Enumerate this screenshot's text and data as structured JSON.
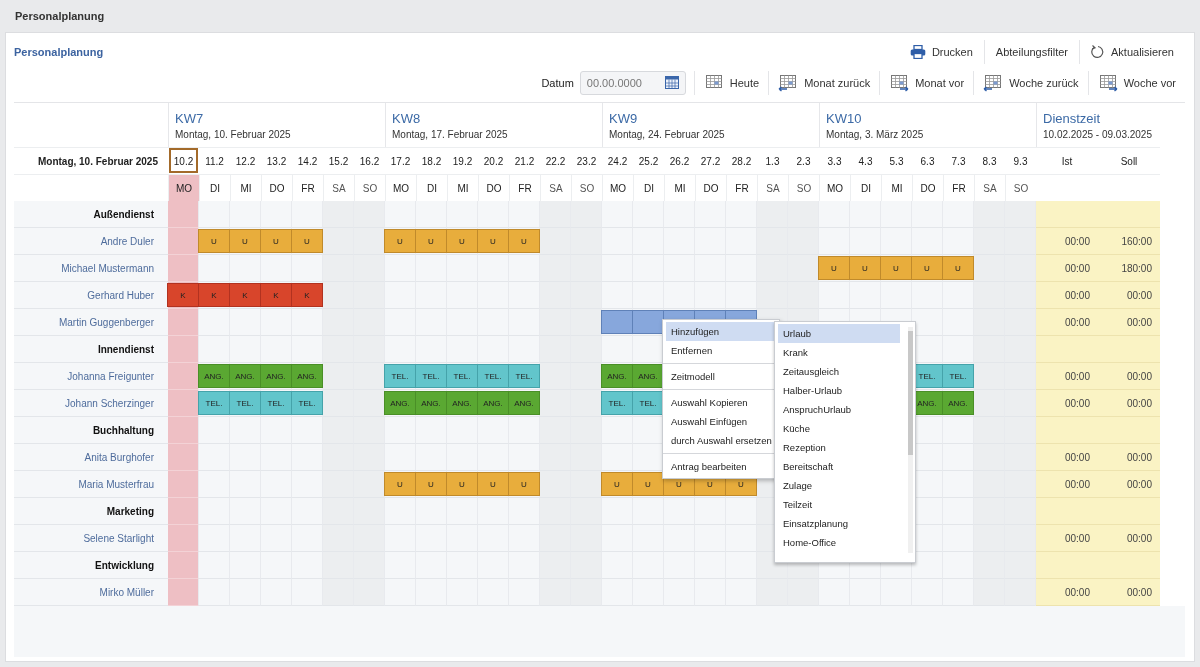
{
  "app_title": "Personalplanung",
  "panel_title": "Personalplanung",
  "toolbar_top": [
    {
      "label": "Drucken",
      "kind": "print"
    },
    {
      "label": "Abteilungsfilter",
      "kind": "plain"
    },
    {
      "label": "Aktualisieren",
      "kind": "refresh"
    }
  ],
  "date_field": {
    "label": "Datum",
    "placeholder": "00.00.0000"
  },
  "nav_buttons": [
    {
      "label": "Heute",
      "kind": "today"
    },
    {
      "label": "Monat zurück",
      "kind": "back"
    },
    {
      "label": "Monat vor",
      "kind": "forward"
    },
    {
      "label": "Woche zurück",
      "kind": "back"
    },
    {
      "label": "Woche vor",
      "kind": "forward"
    }
  ],
  "corner_label": "Montag, 10. Februar 2025",
  "weeks": [
    {
      "title": "KW7",
      "subtitle": "Montag, 10. Februar 2025",
      "days": [
        {
          "date": "10.2",
          "weekday": "MO",
          "selected": true,
          "weekend": false
        },
        {
          "date": "11.2",
          "weekday": "DI",
          "selected": false,
          "weekend": false
        },
        {
          "date": "12.2",
          "weekday": "MI",
          "selected": false,
          "weekend": false
        },
        {
          "date": "13.2",
          "weekday": "DO",
          "selected": false,
          "weekend": false
        },
        {
          "date": "14.2",
          "weekday": "FR",
          "selected": false,
          "weekend": false
        },
        {
          "date": "15.2",
          "weekday": "SA",
          "selected": false,
          "weekend": true
        },
        {
          "date": "16.2",
          "weekday": "SO",
          "selected": false,
          "weekend": true
        }
      ]
    },
    {
      "title": "KW8",
      "subtitle": "Montag, 17. Februar 2025",
      "days": [
        {
          "date": "17.2",
          "weekday": "MO",
          "selected": false,
          "weekend": false
        },
        {
          "date": "18.2",
          "weekday": "DI",
          "selected": false,
          "weekend": false
        },
        {
          "date": "19.2",
          "weekday": "MI",
          "selected": false,
          "weekend": false
        },
        {
          "date": "20.2",
          "weekday": "DO",
          "selected": false,
          "weekend": false
        },
        {
          "date": "21.2",
          "weekday": "FR",
          "selected": false,
          "weekend": false
        },
        {
          "date": "22.2",
          "weekday": "SA",
          "selected": false,
          "weekend": true
        },
        {
          "date": "23.2",
          "weekday": "SO",
          "selected": false,
          "weekend": true
        }
      ]
    },
    {
      "title": "KW9",
      "subtitle": "Montag, 24. Februar 2025",
      "days": [
        {
          "date": "24.2",
          "weekday": "MO",
          "selected": false,
          "weekend": false
        },
        {
          "date": "25.2",
          "weekday": "DI",
          "selected": false,
          "weekend": false
        },
        {
          "date": "26.2",
          "weekday": "MI",
          "selected": false,
          "weekend": false
        },
        {
          "date": "27.2",
          "weekday": "DO",
          "selected": false,
          "weekend": false
        },
        {
          "date": "28.2",
          "weekday": "FR",
          "selected": false,
          "weekend": false
        },
        {
          "date": "1.3",
          "weekday": "SA",
          "selected": false,
          "weekend": true
        },
        {
          "date": "2.3",
          "weekday": "SO",
          "selected": false,
          "weekend": true
        }
      ]
    },
    {
      "title": "KW10",
      "subtitle": "Montag, 3. März 2025",
      "days": [
        {
          "date": "3.3",
          "weekday": "MO",
          "selected": false,
          "weekend": false
        },
        {
          "date": "4.3",
          "weekday": "DI",
          "selected": false,
          "weekend": false
        },
        {
          "date": "5.3",
          "weekday": "MI",
          "selected": false,
          "weekend": false
        },
        {
          "date": "6.3",
          "weekday": "DO",
          "selected": false,
          "weekend": false
        },
        {
          "date": "7.3",
          "weekday": "FR",
          "selected": false,
          "weekend": false
        },
        {
          "date": "8.3",
          "weekday": "SA",
          "selected": false,
          "weekend": true
        },
        {
          "date": "9.3",
          "weekday": "SO",
          "selected": false,
          "weekend": true
        }
      ]
    }
  ],
  "totals_header": {
    "title": "Dienstzeit",
    "range": "10.02.2025 - 09.03.2025",
    "columns": [
      "Ist",
      "Soll"
    ]
  },
  "rows": [
    {
      "kind": "group",
      "label": "Außendienst"
    },
    {
      "kind": "person",
      "label": "Andre Duler",
      "ist": "00:00",
      "soll": "160:00",
      "cells": [
        {
          "kind": "empty"
        },
        {
          "kind": "vacation",
          "code": "U"
        },
        {
          "kind": "vacation",
          "code": "U"
        },
        {
          "kind": "vacation",
          "code": "U"
        },
        {
          "kind": "vacation",
          "code": "U"
        },
        {
          "kind": "empty"
        },
        {
          "kind": "empty"
        },
        {
          "kind": "vacation",
          "code": "U"
        },
        {
          "kind": "vacation",
          "code": "U"
        },
        {
          "kind": "vacation",
          "code": "U"
        },
        {
          "kind": "vacation",
          "code": "U"
        },
        {
          "kind": "vacation",
          "code": "U"
        },
        {
          "kind": "empty"
        },
        {
          "kind": "empty"
        },
        {
          "kind": "empty"
        },
        {
          "kind": "empty"
        },
        {
          "kind": "empty"
        },
        {
          "kind": "empty"
        },
        {
          "kind": "empty"
        },
        {
          "kind": "empty"
        },
        {
          "kind": "empty"
        },
        {
          "kind": "empty"
        },
        {
          "kind": "empty"
        },
        {
          "kind": "empty"
        },
        {
          "kind": "empty"
        },
        {
          "kind": "empty"
        },
        {
          "kind": "empty"
        },
        {
          "kind": "empty"
        }
      ]
    },
    {
      "kind": "person",
      "label": "Michael Mustermann",
      "ist": "00:00",
      "soll": "180:00",
      "cells": [
        {
          "kind": "empty"
        },
        {
          "kind": "empty"
        },
        {
          "kind": "empty"
        },
        {
          "kind": "empty"
        },
        {
          "kind": "empty"
        },
        {
          "kind": "empty"
        },
        {
          "kind": "empty"
        },
        {
          "kind": "empty"
        },
        {
          "kind": "empty"
        },
        {
          "kind": "empty"
        },
        {
          "kind": "empty"
        },
        {
          "kind": "empty"
        },
        {
          "kind": "empty"
        },
        {
          "kind": "empty"
        },
        {
          "kind": "empty"
        },
        {
          "kind": "empty"
        },
        {
          "kind": "empty"
        },
        {
          "kind": "empty"
        },
        {
          "kind": "empty"
        },
        {
          "kind": "empty"
        },
        {
          "kind": "empty"
        },
        {
          "kind": "vacation",
          "code": "U"
        },
        {
          "kind": "vacation",
          "code": "U"
        },
        {
          "kind": "vacation",
          "code": "U"
        },
        {
          "kind": "vacation",
          "code": "U"
        },
        {
          "kind": "vacation",
          "code": "U"
        },
        {
          "kind": "empty"
        },
        {
          "kind": "empty"
        }
      ]
    },
    {
      "kind": "person",
      "label": "Gerhard Huber",
      "ist": "00:00",
      "soll": "00:00",
      "cells": [
        {
          "kind": "sick",
          "code": "K"
        },
        {
          "kind": "sick",
          "code": "K"
        },
        {
          "kind": "sick",
          "code": "K"
        },
        {
          "kind": "sick",
          "code": "K"
        },
        {
          "kind": "sick",
          "code": "K"
        },
        {
          "kind": "empty"
        },
        {
          "kind": "empty"
        },
        {
          "kind": "empty"
        },
        {
          "kind": "empty"
        },
        {
          "kind": "empty"
        },
        {
          "kind": "empty"
        },
        {
          "kind": "empty"
        },
        {
          "kind": "empty"
        },
        {
          "kind": "empty"
        },
        {
          "kind": "empty"
        },
        {
          "kind": "empty"
        },
        {
          "kind": "empty"
        },
        {
          "kind": "empty"
        },
        {
          "kind": "empty"
        },
        {
          "kind": "empty"
        },
        {
          "kind": "empty"
        },
        {
          "kind": "empty"
        },
        {
          "kind": "empty"
        },
        {
          "kind": "empty"
        },
        {
          "kind": "empty"
        },
        {
          "kind": "empty"
        },
        {
          "kind": "empty"
        },
        {
          "kind": "empty"
        }
      ]
    },
    {
      "kind": "person",
      "label": "Martin Guggenberger",
      "ist": "00:00",
      "soll": "00:00",
      "cells": [
        {
          "kind": "empty"
        },
        {
          "kind": "empty"
        },
        {
          "kind": "empty"
        },
        {
          "kind": "empty"
        },
        {
          "kind": "empty"
        },
        {
          "kind": "empty"
        },
        {
          "kind": "empty"
        },
        {
          "kind": "empty"
        },
        {
          "kind": "empty"
        },
        {
          "kind": "empty"
        },
        {
          "kind": "empty"
        },
        {
          "kind": "empty"
        },
        {
          "kind": "empty"
        },
        {
          "kind": "empty"
        },
        {
          "kind": "selection"
        },
        {
          "kind": "selection"
        },
        {
          "kind": "selection"
        },
        {
          "kind": "selection"
        },
        {
          "kind": "selection"
        },
        {
          "kind": "empty"
        },
        {
          "kind": "empty"
        },
        {
          "kind": "empty"
        },
        {
          "kind": "empty"
        },
        {
          "kind": "empty"
        },
        {
          "kind": "empty"
        },
        {
          "kind": "empty"
        },
        {
          "kind": "empty"
        },
        {
          "kind": "empty"
        }
      ]
    },
    {
      "kind": "group",
      "label": "Innendienst"
    },
    {
      "kind": "person",
      "label": "Johanna Freigunter",
      "ist": "00:00",
      "soll": "00:00",
      "cells": [
        {
          "kind": "empty"
        },
        {
          "kind": "presence",
          "code": "ANG."
        },
        {
          "kind": "presence",
          "code": "ANG."
        },
        {
          "kind": "presence",
          "code": "ANG."
        },
        {
          "kind": "presence",
          "code": "ANG."
        },
        {
          "kind": "empty"
        },
        {
          "kind": "empty"
        },
        {
          "kind": "phone",
          "code": "TEL."
        },
        {
          "kind": "phone",
          "code": "TEL."
        },
        {
          "kind": "phone",
          "code": "TEL."
        },
        {
          "kind": "phone",
          "code": "TEL."
        },
        {
          "kind": "phone",
          "code": "TEL."
        },
        {
          "kind": "empty"
        },
        {
          "kind": "empty"
        },
        {
          "kind": "presence",
          "code": "ANG."
        },
        {
          "kind": "presence",
          "code": "ANG."
        },
        {
          "kind": "empty"
        },
        {
          "kind": "empty"
        },
        {
          "kind": "empty"
        },
        {
          "kind": "empty"
        },
        {
          "kind": "empty"
        },
        {
          "kind": "empty"
        },
        {
          "kind": "empty"
        },
        {
          "kind": "empty"
        },
        {
          "kind": "phone",
          "code": "TEL."
        },
        {
          "kind": "phone",
          "code": "TEL."
        },
        {
          "kind": "empty"
        },
        {
          "kind": "empty"
        }
      ]
    },
    {
      "kind": "person",
      "label": "Johann Scherzinger",
      "ist": "00:00",
      "soll": "00:00",
      "cells": [
        {
          "kind": "empty"
        },
        {
          "kind": "phone",
          "code": "TEL."
        },
        {
          "kind": "phone",
          "code": "TEL."
        },
        {
          "kind": "phone",
          "code": "TEL."
        },
        {
          "kind": "phone",
          "code": "TEL."
        },
        {
          "kind": "empty"
        },
        {
          "kind": "empty"
        },
        {
          "kind": "presence",
          "code": "ANG."
        },
        {
          "kind": "presence",
          "code": "ANG."
        },
        {
          "kind": "presence",
          "code": "ANG."
        },
        {
          "kind": "presence",
          "code": "ANG."
        },
        {
          "kind": "presence",
          "code": "ANG."
        },
        {
          "kind": "empty"
        },
        {
          "kind": "empty"
        },
        {
          "kind": "phone",
          "code": "TEL."
        },
        {
          "kind": "phone",
          "code": "TEL."
        },
        {
          "kind": "empty"
        },
        {
          "kind": "empty"
        },
        {
          "kind": "empty"
        },
        {
          "kind": "empty"
        },
        {
          "kind": "empty"
        },
        {
          "kind": "empty"
        },
        {
          "kind": "empty"
        },
        {
          "kind": "empty"
        },
        {
          "kind": "presence",
          "code": "ANG."
        },
        {
          "kind": "presence",
          "code": "ANG."
        },
        {
          "kind": "empty"
        },
        {
          "kind": "empty"
        }
      ]
    },
    {
      "kind": "group",
      "label": "Buchhaltung"
    },
    {
      "kind": "person",
      "label": "Anita Burghofer",
      "ist": "00:00",
      "soll": "00:00",
      "cells": [
        {
          "kind": "empty"
        },
        {
          "kind": "empty"
        },
        {
          "kind": "empty"
        },
        {
          "kind": "empty"
        },
        {
          "kind": "empty"
        },
        {
          "kind": "empty"
        },
        {
          "kind": "empty"
        },
        {
          "kind": "empty"
        },
        {
          "kind": "empty"
        },
        {
          "kind": "empty"
        },
        {
          "kind": "empty"
        },
        {
          "kind": "empty"
        },
        {
          "kind": "empty"
        },
        {
          "kind": "empty"
        },
        {
          "kind": "empty"
        },
        {
          "kind": "empty"
        },
        {
          "kind": "empty"
        },
        {
          "kind": "empty"
        },
        {
          "kind": "empty"
        },
        {
          "kind": "empty"
        },
        {
          "kind": "empty"
        },
        {
          "kind": "empty"
        },
        {
          "kind": "empty"
        },
        {
          "kind": "empty"
        },
        {
          "kind": "empty"
        },
        {
          "kind": "empty"
        },
        {
          "kind": "empty"
        },
        {
          "kind": "empty"
        }
      ]
    },
    {
      "kind": "person",
      "label": "Maria Musterfrau",
      "ist": "00:00",
      "soll": "00:00",
      "cells": [
        {
          "kind": "empty"
        },
        {
          "kind": "empty"
        },
        {
          "kind": "empty"
        },
        {
          "kind": "empty"
        },
        {
          "kind": "empty"
        },
        {
          "kind": "empty"
        },
        {
          "kind": "empty"
        },
        {
          "kind": "vacation",
          "code": "U"
        },
        {
          "kind": "vacation",
          "code": "U"
        },
        {
          "kind": "vacation",
          "code": "U"
        },
        {
          "kind": "vacation",
          "code": "U"
        },
        {
          "kind": "vacation",
          "code": "U"
        },
        {
          "kind": "empty"
        },
        {
          "kind": "empty"
        },
        {
          "kind": "vacation",
          "code": "U"
        },
        {
          "kind": "vacation",
          "code": "U"
        },
        {
          "kind": "vacation",
          "code": "U"
        },
        {
          "kind": "vacation",
          "code": "U"
        },
        {
          "kind": "vacation",
          "code": "U"
        },
        {
          "kind": "empty"
        },
        {
          "kind": "empty"
        },
        {
          "kind": "empty"
        },
        {
          "kind": "empty"
        },
        {
          "kind": "empty"
        },
        {
          "kind": "empty"
        },
        {
          "kind": "empty"
        },
        {
          "kind": "empty"
        },
        {
          "kind": "empty"
        }
      ]
    },
    {
      "kind": "group",
      "label": "Marketing"
    },
    {
      "kind": "person",
      "label": "Selene Starlight",
      "ist": "00:00",
      "soll": "00:00",
      "cells": [
        {
          "kind": "empty"
        },
        {
          "kind": "empty"
        },
        {
          "kind": "empty"
        },
        {
          "kind": "empty"
        },
        {
          "kind": "empty"
        },
        {
          "kind": "empty"
        },
        {
          "kind": "empty"
        },
        {
          "kind": "empty"
        },
        {
          "kind": "empty"
        },
        {
          "kind": "empty"
        },
        {
          "kind": "empty"
        },
        {
          "kind": "empty"
        },
        {
          "kind": "empty"
        },
        {
          "kind": "empty"
        },
        {
          "kind": "empty"
        },
        {
          "kind": "empty"
        },
        {
          "kind": "empty"
        },
        {
          "kind": "empty"
        },
        {
          "kind": "empty"
        },
        {
          "kind": "empty"
        },
        {
          "kind": "empty"
        },
        {
          "kind": "empty"
        },
        {
          "kind": "empty"
        },
        {
          "kind": "empty"
        },
        {
          "kind": "empty"
        },
        {
          "kind": "empty"
        },
        {
          "kind": "empty"
        },
        {
          "kind": "empty"
        }
      ]
    },
    {
      "kind": "group",
      "label": "Entwicklung"
    },
    {
      "kind": "person",
      "label": "Mirko Müller",
      "ist": "00:00",
      "soll": "00:00",
      "cells": [
        {
          "kind": "empty"
        },
        {
          "kind": "empty"
        },
        {
          "kind": "empty"
        },
        {
          "kind": "empty"
        },
        {
          "kind": "empty"
        },
        {
          "kind": "empty"
        },
        {
          "kind": "empty"
        },
        {
          "kind": "empty"
        },
        {
          "kind": "empty"
        },
        {
          "kind": "empty"
        },
        {
          "kind": "empty"
        },
        {
          "kind": "empty"
        },
        {
          "kind": "empty"
        },
        {
          "kind": "empty"
        },
        {
          "kind": "empty"
        },
        {
          "kind": "empty"
        },
        {
          "kind": "empty"
        },
        {
          "kind": "empty"
        },
        {
          "kind": "empty"
        },
        {
          "kind": "empty"
        },
        {
          "kind": "empty"
        },
        {
          "kind": "empty"
        },
        {
          "kind": "empty"
        },
        {
          "kind": "empty"
        },
        {
          "kind": "empty"
        },
        {
          "kind": "empty"
        },
        {
          "kind": "empty"
        },
        {
          "kind": "empty"
        }
      ]
    }
  ],
  "context_menu": {
    "groups": [
      [
        {
          "label": "Hinzufügen",
          "selected": true
        },
        {
          "label": "Entfernen",
          "selected": false
        }
      ],
      [
        {
          "label": "Zeitmodell",
          "selected": false
        }
      ],
      [
        {
          "label": "Auswahl Kopieren",
          "selected": false
        },
        {
          "label": "Auswahl Einfügen",
          "selected": false
        },
        {
          "label": "durch Auswahl ersetzen",
          "selected": false
        }
      ],
      [
        {
          "label": "Antrag bearbeiten",
          "selected": false
        }
      ]
    ]
  },
  "submenu": {
    "items": [
      {
        "label": "Urlaub",
        "selected": true
      },
      {
        "label": "Krank",
        "selected": false
      },
      {
        "label": "Zeitausgleich",
        "selected": false
      },
      {
        "label": "Halber-Urlaub",
        "selected": false
      },
      {
        "label": "AnspruchUrlaub",
        "selected": false
      },
      {
        "label": "Küche",
        "selected": false
      },
      {
        "label": "Rezeption",
        "selected": false
      },
      {
        "label": "Bereitschaft",
        "selected": false
      },
      {
        "label": "Zulage",
        "selected": false
      },
      {
        "label": "Teilzeit",
        "selected": false
      },
      {
        "label": "Einsatzplanung",
        "selected": false
      },
      {
        "label": "Home-Office",
        "selected": false
      }
    ]
  }
}
